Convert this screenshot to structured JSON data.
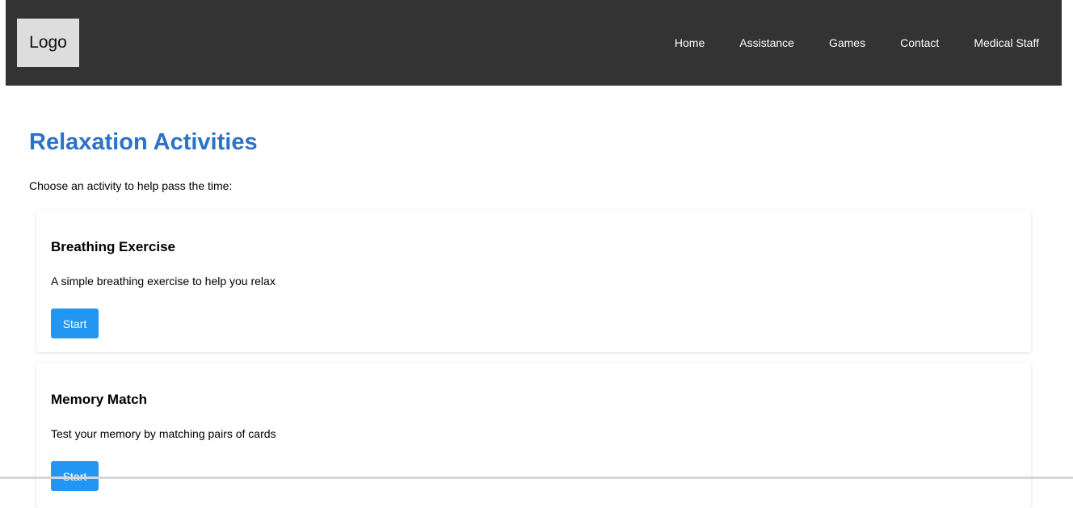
{
  "header": {
    "logo_text": "Logo",
    "nav": [
      {
        "label": "Home"
      },
      {
        "label": "Assistance"
      },
      {
        "label": "Games"
      },
      {
        "label": "Contact"
      },
      {
        "label": "Medical Staff"
      }
    ]
  },
  "main": {
    "title": "Relaxation Activities",
    "intro": "Choose an activity to help pass the time:",
    "activities": [
      {
        "title": "Breathing Exercise",
        "description": "A simple breathing exercise to help you relax",
        "button_label": "Start"
      },
      {
        "title": "Memory Match",
        "description": "Test your memory by matching pairs of cards",
        "button_label": "Start"
      }
    ]
  },
  "colors": {
    "header_bg": "#333333",
    "logo_bg": "#dddddd",
    "title": "#2b72c9",
    "button": "#2196f3"
  }
}
